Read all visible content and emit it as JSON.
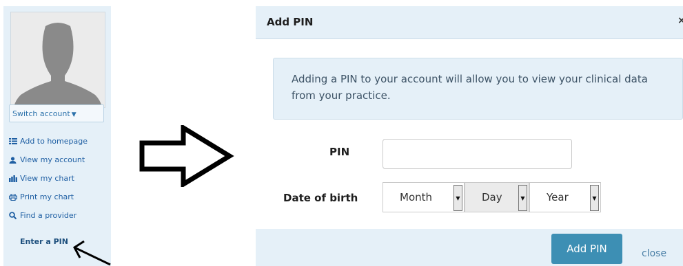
{
  "sidebar": {
    "switch_account_label": "Switch account",
    "links": [
      {
        "label": "Add to homepage",
        "icon": "list-icon"
      },
      {
        "label": "View my account",
        "icon": "user-icon"
      },
      {
        "label": "View my chart",
        "icon": "chart-icon"
      },
      {
        "label": "Print my chart",
        "icon": "print-icon"
      },
      {
        "label": "Find a provider",
        "icon": "search-icon"
      }
    ],
    "enter_pin_label": "Enter a PIN"
  },
  "modal": {
    "title": "Add PIN",
    "close_x": "×",
    "info_text": "Adding a PIN to your account will allow you to view your clinical data from your practice.",
    "pin_label": "PIN",
    "pin_value": "",
    "dob_label": "Date of birth",
    "month_label": "Month",
    "day_label": "Day",
    "year_label": "Year",
    "submit_label": "Add PIN",
    "close_label": "close"
  },
  "colors": {
    "panel_bg": "#e5f0f8",
    "link": "#1f5fa3",
    "primary_button": "#3d8fb4"
  }
}
